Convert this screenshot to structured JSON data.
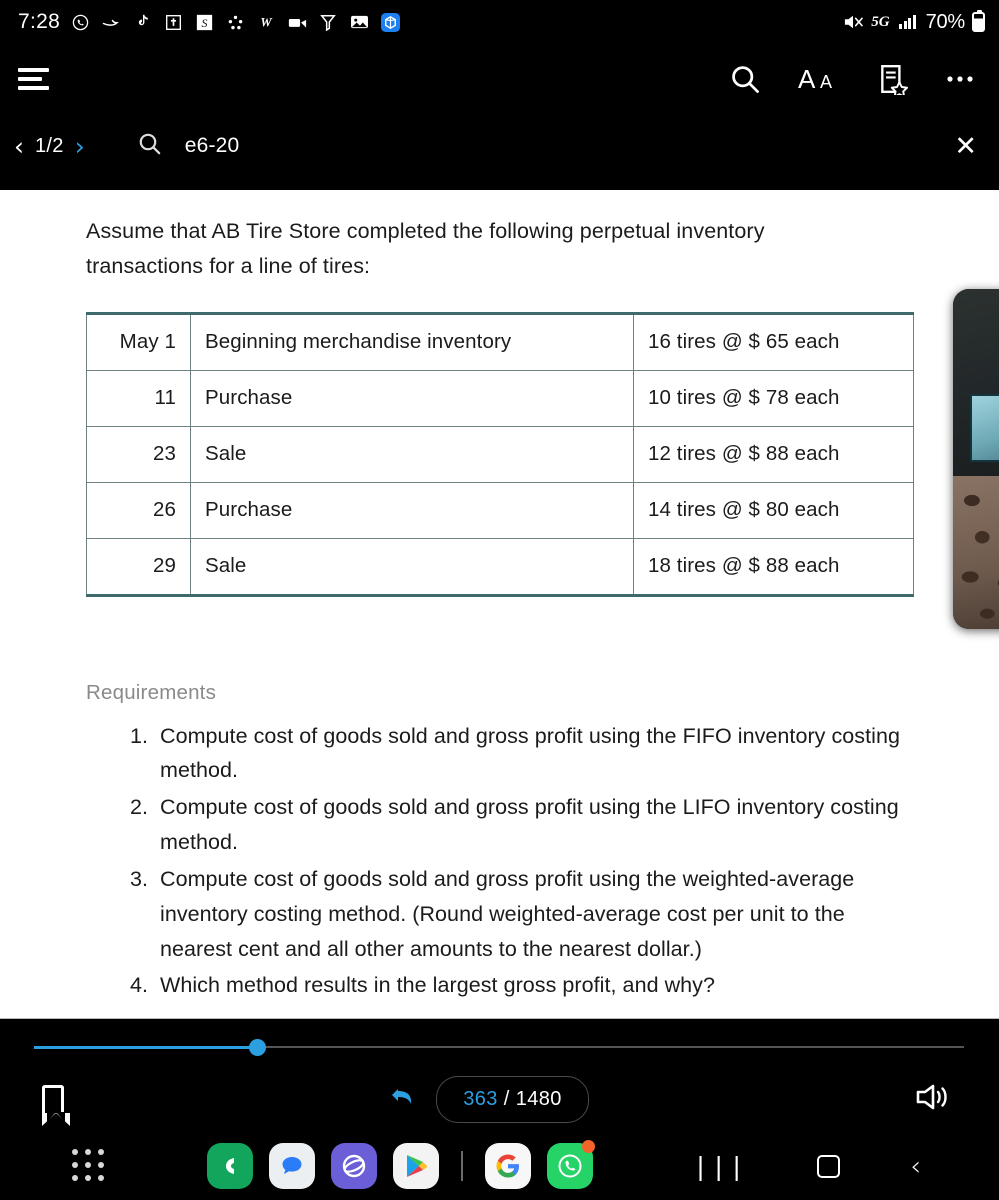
{
  "status_bar": {
    "clock": "7:28",
    "left_icons": [
      {
        "name": "whatsapp-icon",
        "glyph": "◔"
      },
      {
        "name": "arrow-icon",
        "glyph": "➜"
      },
      {
        "name": "tiktok-icon",
        "glyph": "♪"
      },
      {
        "name": "bible-icon",
        "glyph": "✝"
      },
      {
        "name": "samsung-notes-icon",
        "glyph": "S"
      },
      {
        "name": "smartthings-icon",
        "glyph": "❊"
      },
      {
        "name": "word-icon",
        "glyph": "W"
      },
      {
        "name": "camcorder-icon",
        "glyph": "▣"
      },
      {
        "name": "filter-icon",
        "glyph": "Y"
      },
      {
        "name": "gallery-icon",
        "glyph": "▤"
      },
      {
        "name": "blue-app-icon",
        "glyph": "◆"
      }
    ],
    "mute_icon": "mute-icon",
    "network": "5G",
    "battery_percent": "70%"
  },
  "toolbar": {
    "menu_label": "menu-icon",
    "actions": [
      {
        "name": "search-icon",
        "label": "Search"
      },
      {
        "name": "font-size-icon",
        "label": "AA"
      },
      {
        "name": "bookmark-list-icon",
        "label": "Bookmarks"
      },
      {
        "name": "more-options-icon",
        "label": "More"
      }
    ]
  },
  "find_bar": {
    "prev": "‹",
    "counter": "1/2",
    "next": "›",
    "search_icon": "search-icon",
    "query": "e6-20",
    "placeholder": "Search",
    "close": "✕"
  },
  "document": {
    "intro": "Assume that AB Tire Store completed the following perpetual inventory transactions for a line of tires:",
    "table": {
      "rows": [
        {
          "date": "May 1",
          "description": "Beginning merchandise inventory",
          "amount": "16 tires @ $ 65 each"
        },
        {
          "date": "11",
          "description": "Purchase",
          "amount": "10 tires @ $ 78 each"
        },
        {
          "date": "23",
          "description": "Sale",
          "amount": "12 tires @ $ 88 each"
        },
        {
          "date": "26",
          "description": "Purchase",
          "amount": "14 tires @ $ 80 each"
        },
        {
          "date": "29",
          "description": "Sale",
          "amount": "18 tires @ $ 88 each"
        }
      ]
    },
    "requirements_title": "Requirements",
    "requirements": [
      "Compute cost of goods sold and gross profit using the FIFO inventory costing method.",
      "Compute cost of goods sold and gross profit using the LIFO inventory costing method.",
      "Compute cost of goods sold and gross profit using the weighted-average inventory costing method. (Round weighted-average cost per unit to the nearest cent and all other amounts to the nearest dollar.)",
      "Which method results in the largest gross profit, and why?"
    ]
  },
  "pip": {
    "name": "picture-in-picture-video"
  },
  "bottom": {
    "slider_progress_percent": 24,
    "bookmark_icon": "bookmark-icon",
    "undo_icon": "undo-icon",
    "current_page": "363",
    "separator": "/",
    "total_pages": "1480",
    "speaker_icon": "speaker-icon"
  },
  "dock": {
    "apps_grid_icon": "app-drawer-icon",
    "apps": [
      {
        "name": "phone-app-icon",
        "glyph": "📞"
      },
      {
        "name": "messages-app-icon",
        "glyph": "💬"
      },
      {
        "name": "samsung-internet-app-icon",
        "glyph": "◯"
      },
      {
        "name": "play-store-app-icon",
        "glyph": "▶"
      },
      {
        "name": "google-app-icon",
        "glyph": "G"
      },
      {
        "name": "whatsapp-app-icon",
        "glyph": "✆"
      }
    ],
    "nav_keys": [
      {
        "name": "recents-button",
        "glyph": "|||"
      },
      {
        "name": "home-button",
        "glyph": "◻"
      },
      {
        "name": "back-button",
        "glyph": "‹"
      }
    ]
  },
  "colors": {
    "accent_blue": "#2b9fe0",
    "table_border": "#6d8183",
    "page_bg": "#ffffff",
    "chrome_bg": "#000000"
  }
}
